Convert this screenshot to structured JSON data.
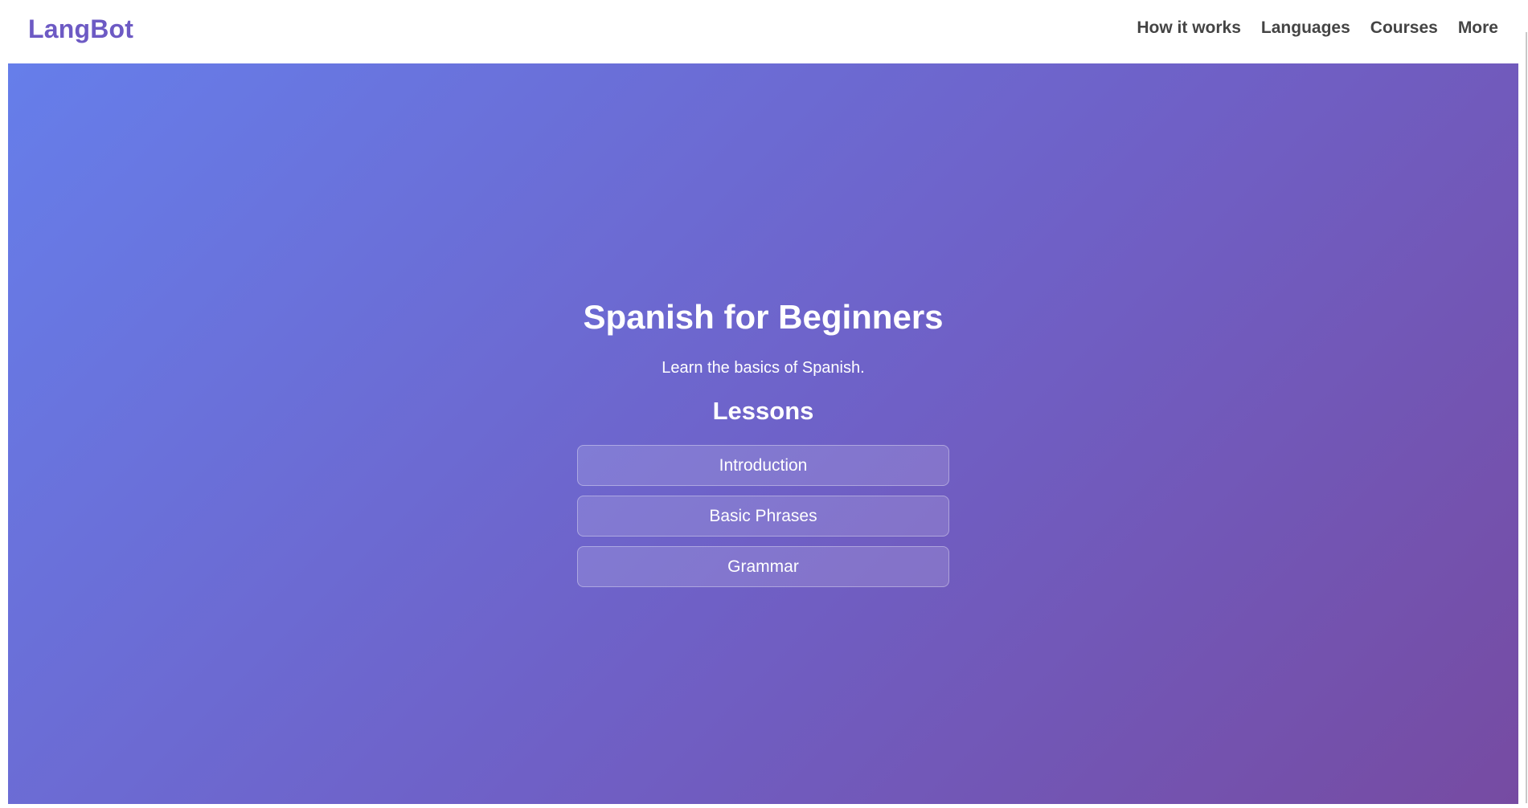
{
  "header": {
    "logo": "LangBot",
    "nav": [
      "How it works",
      "Languages",
      "Courses",
      "More"
    ]
  },
  "hero": {
    "title": "Spanish for Beginners",
    "subtitle": "Learn the basics of Spanish.",
    "lessons_heading": "Lessons",
    "lessons": [
      "Introduction",
      "Basic Phrases",
      "Grammar"
    ]
  },
  "colors": {
    "brand": "#6d5ac4",
    "gradient_start": "#667eea",
    "gradient_end": "#764ba2",
    "nav_text": "#444444"
  }
}
